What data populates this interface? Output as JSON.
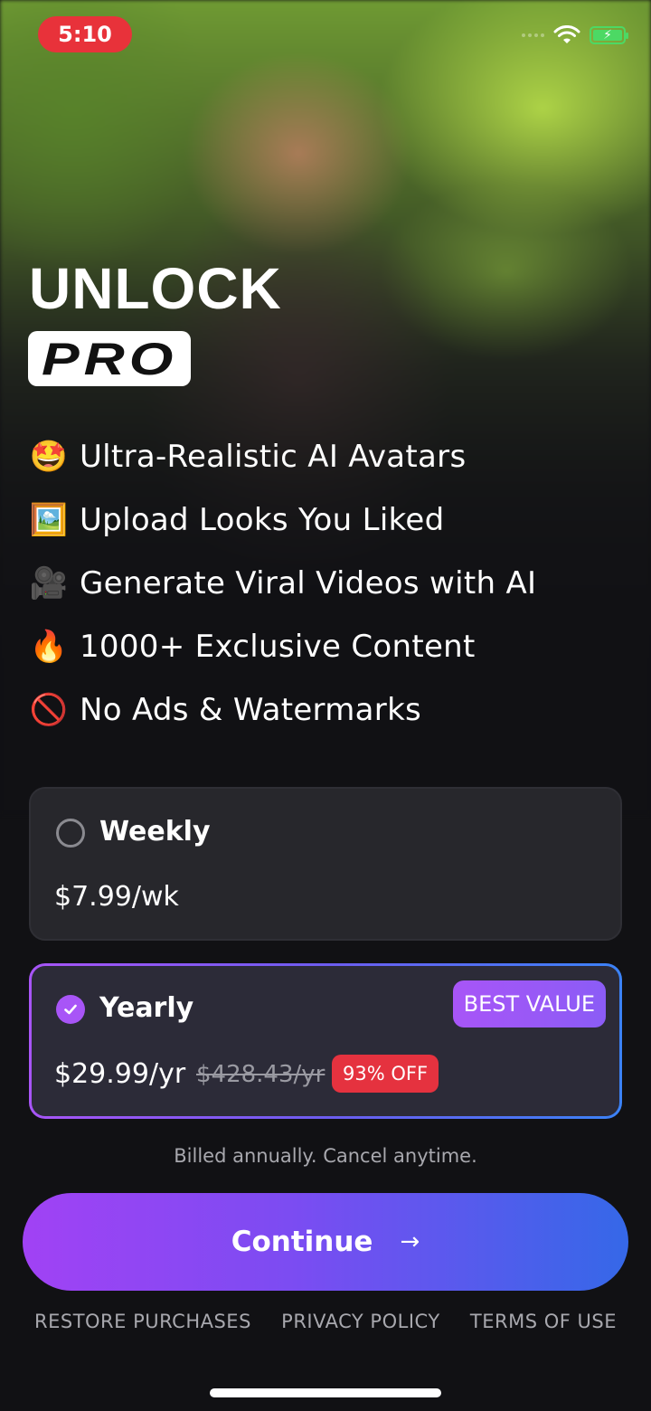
{
  "status_bar": {
    "time": "5:10",
    "battery_icon": "battery-charging-icon",
    "wifi_icon": "wifi-icon"
  },
  "header": {
    "title": "UNLOCK",
    "badge": "PRO"
  },
  "features": [
    {
      "icon": "star-struck-emoji",
      "emoji": "🤩",
      "text": "Ultra-Realistic AI Avatars"
    },
    {
      "icon": "framed-picture-emoji",
      "emoji": "🖼️",
      "text": "Upload Looks You Liked"
    },
    {
      "icon": "movie-camera-emoji",
      "emoji": "🎥",
      "text": "Generate Viral Videos with AI"
    },
    {
      "icon": "fire-emoji",
      "emoji": "🔥",
      "text": "1000+ Exclusive Content"
    },
    {
      "icon": "no-entry-emoji",
      "emoji": "🚫",
      "text": "No Ads & Watermarks"
    }
  ],
  "plans": {
    "weekly": {
      "name": "Weekly",
      "price": "$7.99/wk",
      "selected": false
    },
    "yearly": {
      "name": "Yearly",
      "price": "$29.99/yr",
      "original_price": "$428.43/yr",
      "discount": "93% OFF",
      "badge": "BEST VALUE",
      "selected": true
    }
  },
  "billing_note": "Billed annually. Cancel anytime.",
  "cta": {
    "label": "Continue",
    "arrow": "→"
  },
  "footer": {
    "restore": "RESTORE PURCHASES",
    "privacy": "PRIVACY POLICY",
    "terms": "TERMS OF USE"
  },
  "colors": {
    "accent_purple": "#a855f7",
    "accent_blue": "#3b82f6",
    "discount_red": "#e5323f",
    "status_red": "#e8323a"
  }
}
